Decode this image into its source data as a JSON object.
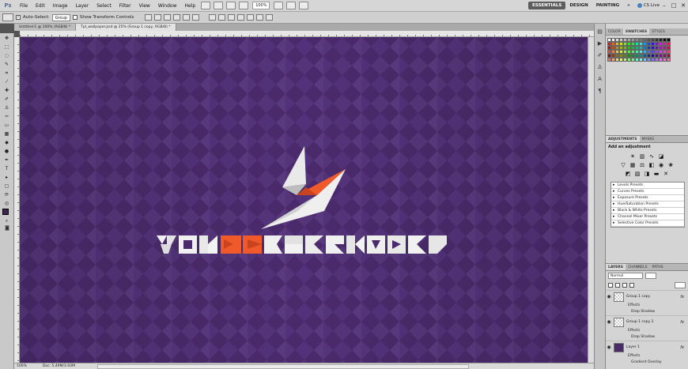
{
  "menubar": {
    "logo": "Ps",
    "items": [
      "File",
      "Edit",
      "Image",
      "Layer",
      "Select",
      "Filter",
      "View",
      "Window",
      "Help"
    ],
    "zoom": "100%",
    "workspaces": [
      "ESSENTIALS",
      "DESIGN",
      "PAINTING"
    ],
    "more": "»",
    "cs_live": "CS Live",
    "window_controls": [
      "–",
      "□",
      "✕"
    ]
  },
  "options": {
    "auto_select_label": "Auto-Select:",
    "auto_select_value": "Group",
    "show_transform_label": "Show Transform Controls"
  },
  "tabs": [
    {
      "label": "Untitled-1 @ 100% (RGB/8) *"
    },
    {
      "label": "Tpl_wallpaper.psd @ 25% (Group 1 copy, RGB/8) *"
    }
  ],
  "status": {
    "zoom": "100%",
    "doc": "Doc: 5.49M/3.93M"
  },
  "swatches_panel": {
    "tabs": [
      "COLOR",
      "SWATCHES",
      "STYLES"
    ]
  },
  "adjustments": {
    "tabs": [
      "ADJUSTMENTS",
      "MASKS"
    ],
    "title": "Add an adjustment",
    "presets": [
      "Levels Presets",
      "Curves Presets",
      "Exposure Presets",
      "Hue/Saturation Presets",
      "Black & White Presets",
      "Channel Mixer Presets",
      "Selective Color Presets"
    ]
  },
  "layers": {
    "tabs": [
      "LAYERS",
      "CHANNELS",
      "PATHS"
    ],
    "blend_mode": "Normal",
    "layers": [
      {
        "name": "Group 1 copy",
        "fx": "fx",
        "effects_label": "Effects",
        "effect": "Drop Shadow"
      },
      {
        "name": "Group 1 copy 2",
        "fx": "fx",
        "effects_label": "Effects",
        "effect": "Drop Shadow"
      },
      {
        "name": "Layer 1",
        "fx": "fx",
        "effects_label": "Effects",
        "effect": "Gradient Overlay"
      }
    ]
  },
  "colors": {
    "canvas_bg": "#4a2a6b",
    "pattern": "#5a3a7e",
    "accent": "#f0592a",
    "logo_light": "#f2f2f2"
  }
}
